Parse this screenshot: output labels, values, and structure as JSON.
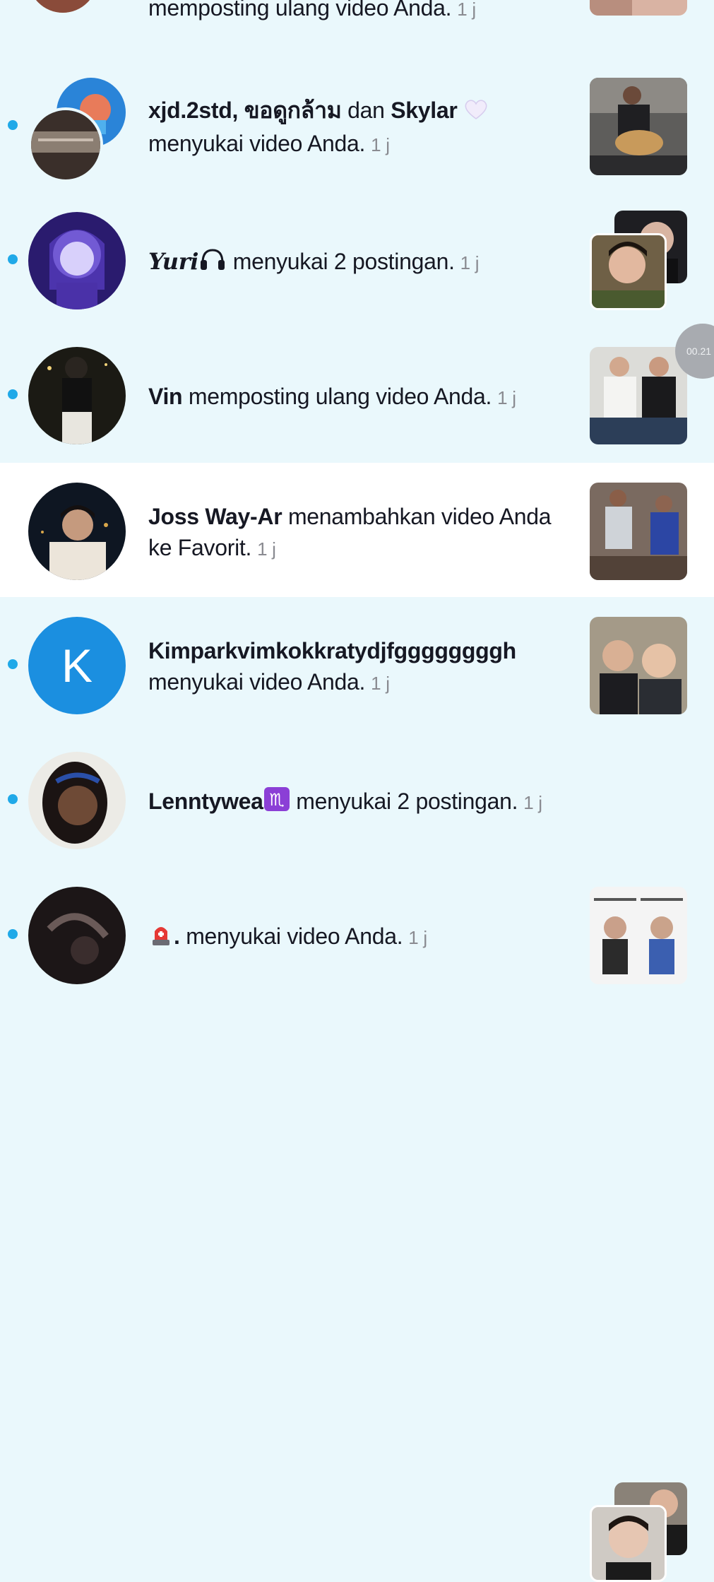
{
  "time_unit": "1 j",
  "notifications": [
    {
      "action": "memposting ulang video Anda.",
      "time": "1 j",
      "unread": true
    },
    {
      "actors": "xjd.2std, ขอดูกล้าม",
      "connector": "dan",
      "actor2": "Skylar",
      "actor2_emoji": "heart-icon",
      "action": "menyukai video Anda.",
      "time": "1 j",
      "unread": true
    },
    {
      "actor": "Yuri",
      "actor_emoji": "headphones-icon",
      "action": "menyukai 2 postingan.",
      "time": "1 j",
      "unread": true
    },
    {
      "actor": "Vin",
      "action": "memposting ulang video Anda.",
      "time": "1 j",
      "unread": true
    },
    {
      "actor": "Joss Way-Ar",
      "action": "menambahkan video Anda ke Favorit.",
      "time": "1 j",
      "unread": false
    },
    {
      "actor": "Kimparkvimkokkratydjfggggggggh",
      "avatar_letter": "K",
      "action": "menyukai video Anda.",
      "time": "1 j",
      "unread": true
    },
    {
      "actor": "Lenntywea",
      "actor_emoji": "scorpio-icon",
      "action": "menyukai 2 postingan.",
      "time": "1 j",
      "unread": true
    },
    {
      "actor": ".",
      "actor_emoji": "siren-icon",
      "action": "menyukai video Anda.",
      "time": "1 j",
      "unread": true
    }
  ],
  "floating_timer": "00.21",
  "colors": {
    "unread_bg": "#eaf8fc",
    "read_bg": "#ffffff",
    "unread_dot": "#20a9e8",
    "avatar_k": "#1b8fe0"
  }
}
